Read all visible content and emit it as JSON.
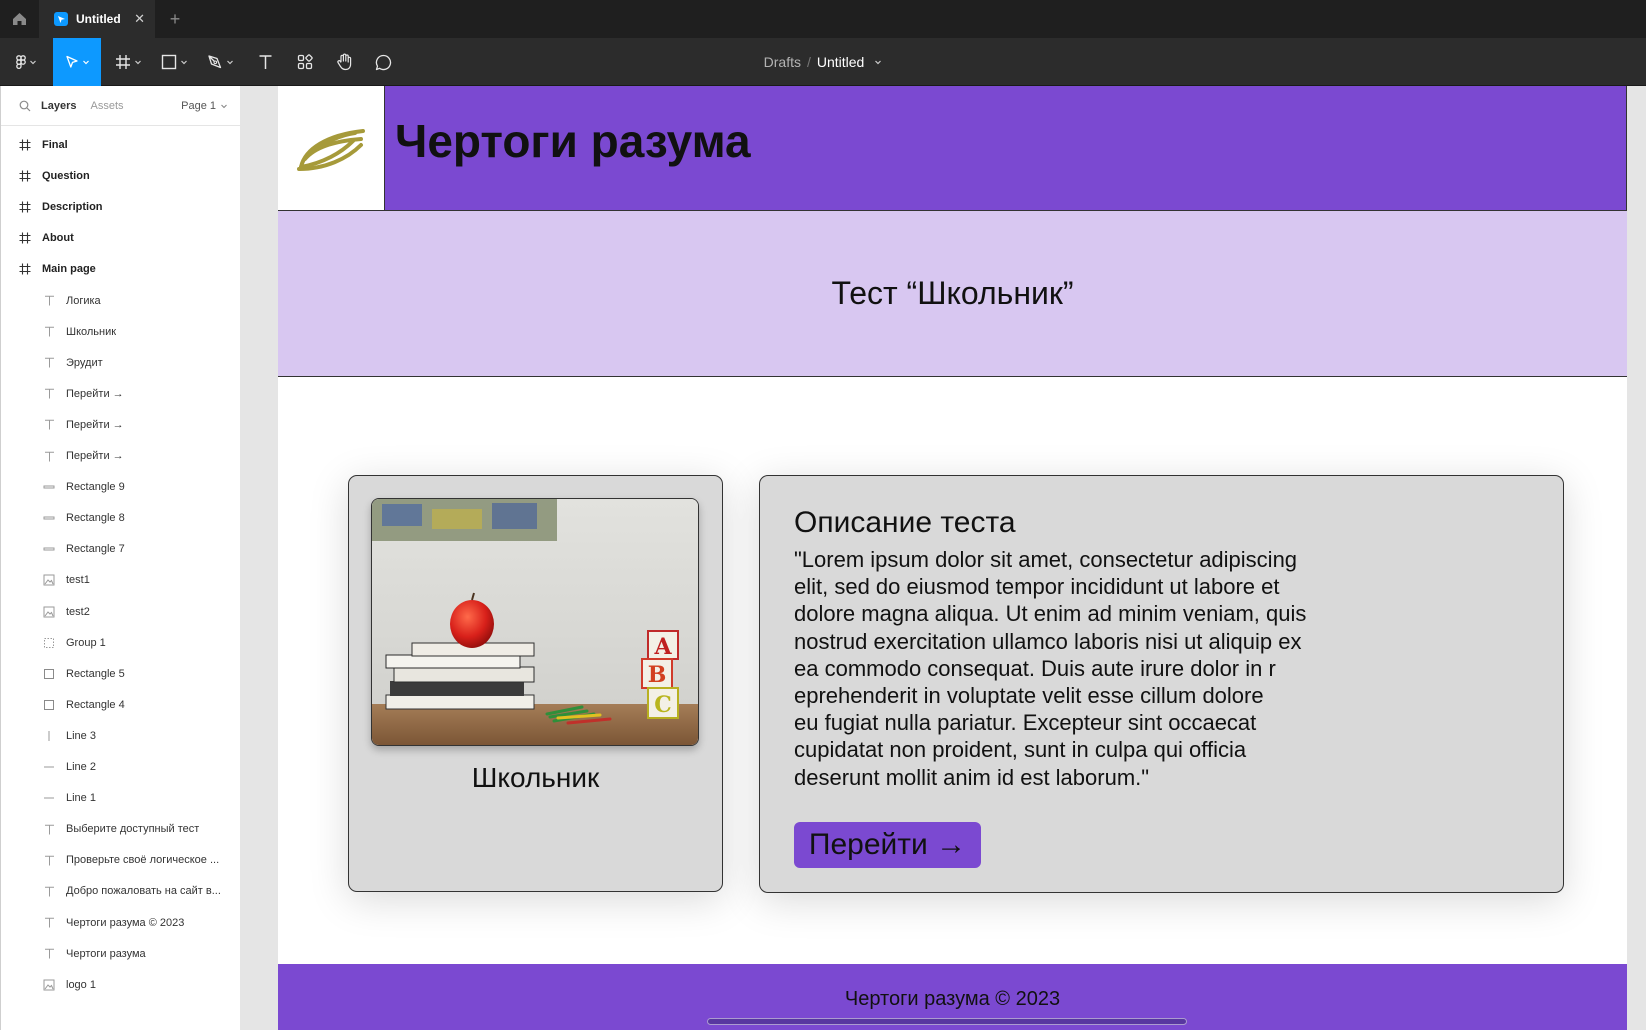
{
  "tabbar": {
    "active_tab": "Untitled",
    "add_symbol": "+",
    "close_symbol": "✕"
  },
  "toolbar": {
    "breadcrumb_drafts": "Drafts",
    "breadcrumb_separator": "/",
    "breadcrumb_file": "Untitled",
    "accent_color": "#0d99ff"
  },
  "left_panel": {
    "tab_layers": "Layers",
    "tab_assets": "Assets",
    "page_selector": "Page 1",
    "layers": [
      {
        "name": "Final",
        "kind": "frame"
      },
      {
        "name": "Question",
        "kind": "frame"
      },
      {
        "name": "Description",
        "kind": "frame"
      },
      {
        "name": "About",
        "kind": "frame"
      },
      {
        "name": "Main page",
        "kind": "frame"
      },
      {
        "name": "Логика",
        "kind": "text"
      },
      {
        "name": "Школьник",
        "kind": "text"
      },
      {
        "name": "Эрудит",
        "kind": "text"
      },
      {
        "name": "Перейти →",
        "kind": "text"
      },
      {
        "name": "Перейти →",
        "kind": "text"
      },
      {
        "name": "Перейти →",
        "kind": "text"
      },
      {
        "name": "Rectangle 9",
        "kind": "rect-h"
      },
      {
        "name": "Rectangle 8",
        "kind": "rect-h"
      },
      {
        "name": "Rectangle 7",
        "kind": "rect-h"
      },
      {
        "name": "test1",
        "kind": "image"
      },
      {
        "name": "test2",
        "kind": "image"
      },
      {
        "name": "Group 1",
        "kind": "group"
      },
      {
        "name": "Rectangle 5",
        "kind": "rect"
      },
      {
        "name": "Rectangle 4",
        "kind": "rect"
      },
      {
        "name": "Line 3",
        "kind": "line-v"
      },
      {
        "name": "Line 2",
        "kind": "line-h"
      },
      {
        "name": "Line 1",
        "kind": "line-h"
      },
      {
        "name": "Выберите доступный тест",
        "kind": "text"
      },
      {
        "name": "Проверьте своё логическое ...",
        "kind": "text"
      },
      {
        "name": "Добро пожаловать на сайт в...",
        "kind": "text"
      },
      {
        "name": "Чертоги разума © 2023",
        "kind": "text"
      },
      {
        "name": "Чертоги разума",
        "kind": "text"
      },
      {
        "name": "logo 1",
        "kind": "image"
      }
    ]
  },
  "canvas": {
    "brand_title": "Чертоги разума",
    "test_title": "Тест “Школьник”",
    "card_label": "Школьник",
    "description_title": "Описание теста",
    "description_lines": [
      "\"Lorem ipsum dolor sit amet, consectetur adipiscing",
      "elit, sed do eiusmod tempor incididunt ut labore et",
      "dolore magna aliqua. Ut enim ad minim veniam, quis",
      "nostrud exercitation ullamco laboris nisi ut aliquip ex",
      "ea commodo consequat. Duis aute irure dolor in r",
      "eprehenderit in voluptate velit esse cillum dolore",
      "eu fugiat nulla pariatur. Excepteur sint occaecat",
      "cupidatat non proident, sunt in culpa qui officia",
      "deserunt mollit anim id est laborum.\""
    ],
    "go_button": "Перейти →",
    "footer_text": "Чертоги разума © 2023",
    "photo_blocks": [
      "A",
      "B",
      "C"
    ],
    "colors": {
      "brand_purple": "#7b49d1",
      "band_lilac": "#d8c7f1",
      "card_gray": "#d9d9d9",
      "logo_gold": "#a69a3a"
    }
  }
}
